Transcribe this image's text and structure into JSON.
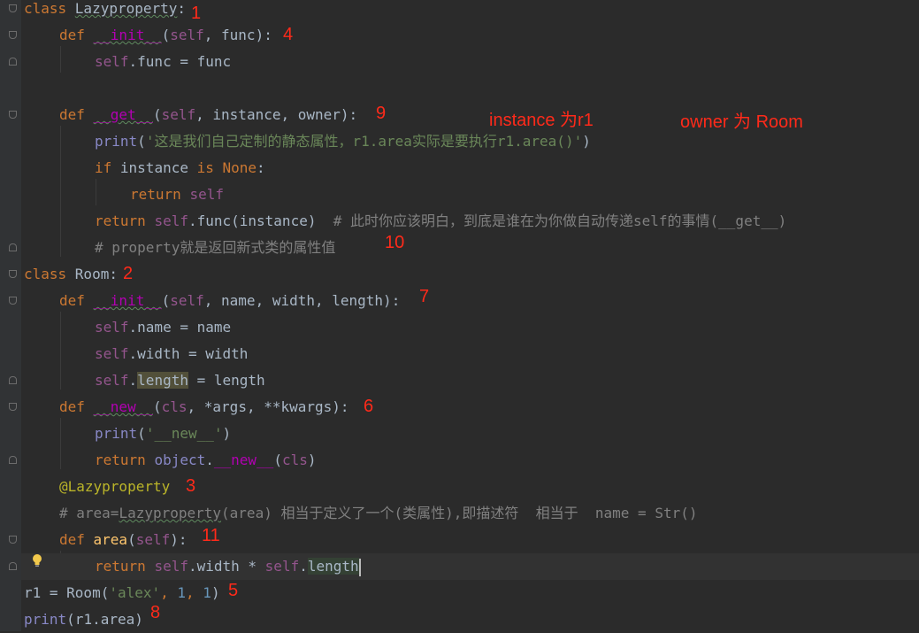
{
  "code": {
    "l1": {
      "kw": "class ",
      "name": "Lazyproperty",
      "colon": ":"
    },
    "l2": {
      "kw": "def ",
      "fn": "__init__",
      "open": "(",
      "self": "self",
      "rest": ", func):"
    },
    "l3": {
      "self": "self",
      "rest": ".func = func"
    },
    "l4": {
      "kw": "def ",
      "fn": "__get__",
      "open": "(",
      "self": "self",
      "rest": ", instance, owner):"
    },
    "l5": {
      "builtin": "print",
      "open": "(",
      "str": "'这是我们自己定制的静态属性，r1.area实际是要执行r1.area()'",
      "close": ")"
    },
    "l6": {
      "kw1": "if ",
      "mid": "instance ",
      "kw2": "is ",
      "kw3": "None",
      "colon": ":"
    },
    "l7": {
      "kw": "return ",
      "self": "self"
    },
    "l8": {
      "kw": "return ",
      "self": "self",
      "rest": ".func(instance)  ",
      "cmt": "# 此时你应该明白，到底是谁在为你做自动传递self的事情(__get__)"
    },
    "l9": {
      "cmt": "# property就是返回新式类的属性值"
    },
    "l10": {
      "kw": "class ",
      "name": "Room",
      "colon": ":"
    },
    "l11": {
      "kw": "def ",
      "fn": "__init__",
      "open": "(",
      "self": "self",
      "rest": ", name, width, length):"
    },
    "l12": {
      "self": "self",
      "rest": ".name = name"
    },
    "l13": {
      "self": "self",
      "rest": ".width = width"
    },
    "l14": {
      "self": "self",
      "dot": ".",
      "hl": "length",
      "rest": " = length"
    },
    "l15": {
      "kw": "def ",
      "fn": "__new__",
      "open": "(",
      "self": "cls",
      "rest": ", *args, **kwargs):"
    },
    "l16": {
      "builtin": "print",
      "open": "(",
      "str": "'__new__'",
      "close": ")"
    },
    "l17": {
      "kw": "return ",
      "builtin": "object",
      "dot": ".",
      "fn": "__new__",
      "open": "(",
      "self": "cls",
      "close": ")"
    },
    "l18": {
      "deco": "@Lazyproperty"
    },
    "l19": {
      "cmt1": "# area=",
      "cmtsq": "Lazyproperty",
      "cmt2": "(area) 相当于定义了一个(类属性),即描述符  相当于  name = Str()"
    },
    "l20": {
      "kw": "def ",
      "fn": "area",
      "open": "(",
      "self": "self",
      "rest": "):"
    },
    "l21": {
      "kw": "return ",
      "self1": "self",
      "mid": ".width * ",
      "self2": "self",
      "dot": ".",
      "hl": "length"
    },
    "l22": {
      "pre": "r1 = Room(",
      "str": "'alex'",
      "c1": ", ",
      "n1": "1",
      "c2": ", ",
      "n2": "1",
      "close": ")"
    },
    "l23": {
      "builtin": "print",
      "rest": "(r1.area)"
    }
  },
  "annotations": {
    "a1": "1",
    "a2": "2",
    "a3": "3",
    "a4": "4",
    "a5": "5",
    "a6": "6",
    "a7": "7",
    "a8": "8",
    "a9": "9",
    "a10": "10",
    "a11": "11",
    "instance_note": "instance 为r1",
    "owner_note": "owner 为 Room"
  },
  "colors": {
    "background": "#2b2b2b",
    "keyword": "#cc7832",
    "self": "#94558d",
    "magic": "#b200b2",
    "string": "#6a8759",
    "number": "#6897bb",
    "comment": "#808080",
    "decorator": "#bbb529",
    "annotation": "#ff2a1a"
  },
  "icons": {
    "gutter_hint": "lightbulb-icon"
  }
}
